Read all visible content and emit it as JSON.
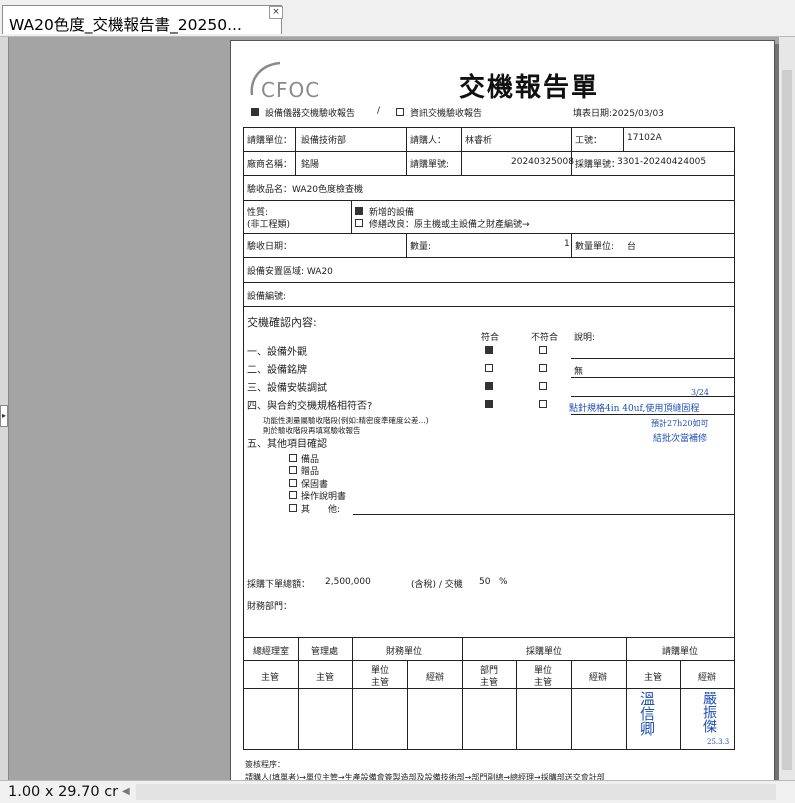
{
  "window": {
    "tab_title": "WA20色度_交機報告書_20250...",
    "close_glyph": "×"
  },
  "status": {
    "page_size": "1.00 x 29.70 cr",
    "scroll_left_glyph": "◀",
    "side_handle_glyph": "▸"
  },
  "doc": {
    "logo": "CFOC",
    "title": "交機報告單",
    "type_equipment": "設備儀器交機驗收報告",
    "type_sep": "/",
    "type_it": "資訊交機驗收報告",
    "fill_date": "填表日期:2025/03/03",
    "r1": {
      "unit_label": "請購單位：",
      "unit_value": "設備技術部",
      "requester_label": "請購人：",
      "requester_value": "林睿析",
      "empno_label": "工號：",
      "empno_value": "17102A"
    },
    "r2": {
      "vendor_label": "廠商名稱：",
      "vendor_value": "銘陽",
      "reqno_label": "請購單號:",
      "reqno_value": "20240325008",
      "pono_label": "採購單號：",
      "pono_value": "3301-20240424005"
    },
    "item_label": "驗收品名：WA20色度檢查機",
    "nature_label": "性質:",
    "nature_sub": "(非工程類)",
    "nature_new": "新增的設備",
    "nature_repair": "修繕改良：原主機或主設備之財產編號→",
    "accept_date_label": "驗收日期：",
    "qty_label": "數量:",
    "qty_value": "1",
    "qty_unit_label": "數量單位:",
    "qty_unit_value": "台",
    "area_label": "設備安置區域: WA20",
    "equip_no_label": "設備編號:",
    "confirm_title": "交機確認內容:",
    "col_ok": "符合",
    "col_ng": "不符合",
    "col_note": "說明:",
    "items": [
      {
        "label": "一、設備外觀",
        "note": ""
      },
      {
        "label": "二、設備銘牌",
        "note": "無"
      },
      {
        "label": "三、設備安裝調試",
        "note": ""
      },
      {
        "label": "四、與合約交機規格相符否?",
        "note": ""
      }
    ],
    "spec_note_1": "功能性測量屬驗收階段(例如:精密度準確度公差...)",
    "spec_note_2": "則於驗收階段再填寫驗收報告",
    "other_title": "五、其他項目確認",
    "others": [
      "備品",
      "贈品",
      "保固書",
      "操作說明書",
      "其　　他:"
    ],
    "handwriting": {
      "line1": "點針規格4in 40uf,使用頂縫固程",
      "line2": "預計27h20如可",
      "line3": "結批次當補修",
      "mark": "3/24"
    },
    "amount_label": "採購下單總額：",
    "amount_value": "2,500,000",
    "tax_label": "(含稅) / 交機",
    "pct_value": "50",
    "pct_sign": "%",
    "finance_label": "財務部門：",
    "sign": {
      "gm": "總經理室",
      "admin": "管理處",
      "finance": "財務單位",
      "purchase": "採購單位",
      "request": "請購單位",
      "supervisor": "主管",
      "unit_supervisor_1": "單位",
      "unit_supervisor_2": "主管",
      "handler": "經辦",
      "dept_supervisor_1": "部門",
      "dept_supervisor_2": "主管",
      "sig1": "溫信卿",
      "sig2": "嚴振傑",
      "sig2_date": "25.3.3"
    },
    "flow_title": "簽核程序：",
    "flow_text": "請購人(填單者)→單位主管→生產設備會簽製造部及設備技術部→部門副總→總經理→採購部送交會計部"
  }
}
